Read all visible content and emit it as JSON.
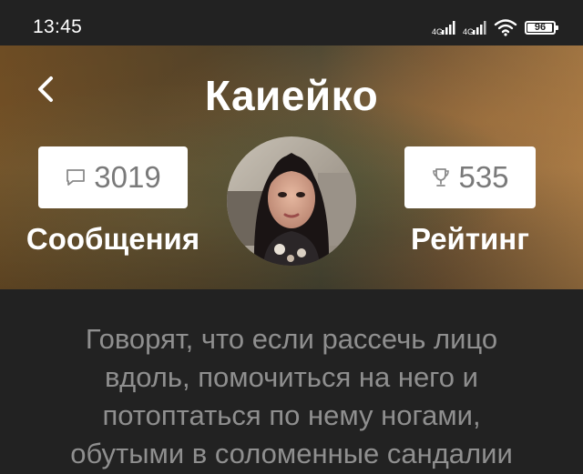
{
  "status_bar": {
    "time": "13:45",
    "battery": "96",
    "battery_level": 0.96,
    "icons": [
      "signal-icon",
      "signal-icon",
      "wifi-icon",
      "battery-icon"
    ]
  },
  "header": {
    "title": "Каиейко",
    "back_icon": "chevron-left-icon"
  },
  "stats": {
    "messages": {
      "icon": "chat-bubble-icon",
      "value": "3019",
      "label": "Сообщения"
    },
    "rating": {
      "icon": "trophy-icon",
      "value": "535",
      "label": "Рейтинг"
    }
  },
  "bio": {
    "lines": [
      "Говорят, что если рассечь лицо",
      "вдоль, помочиться на него и",
      "потоптаться по нему ногами,",
      "обутыми в соломенные сандалии"
    ]
  },
  "colors": {
    "background": "#222222",
    "stat_text": "#7a7a7a",
    "bio_text": "#8f8f8f"
  }
}
